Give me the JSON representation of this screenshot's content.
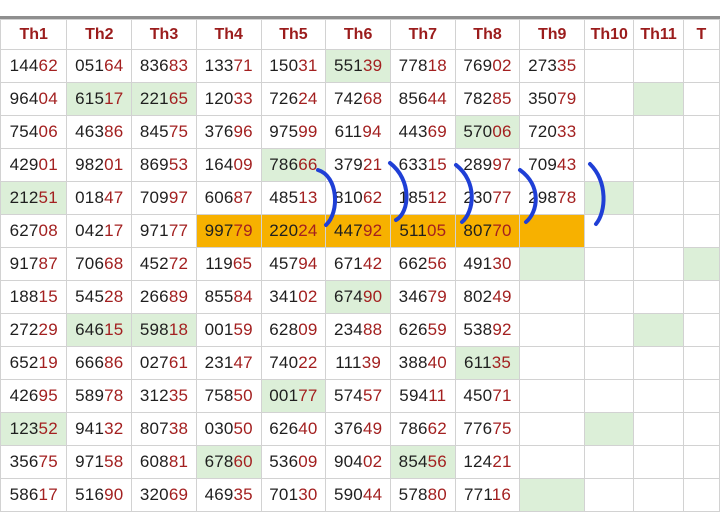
{
  "headers": [
    "Th1",
    "Th2",
    "Th3",
    "Th4",
    "Th5",
    "Th6",
    "Th7",
    "Th8",
    "Th9",
    "Th10",
    "Th11",
    "T"
  ],
  "rows": [
    [
      "14462",
      "05164",
      "83683",
      "13371",
      "15031",
      "55139",
      "77818",
      "76902",
      "27335",
      "",
      "",
      ""
    ],
    [
      "96404",
      "61517",
      "22165",
      "12033",
      "72624",
      "74268",
      "85644",
      "78285",
      "35079",
      "",
      "",
      ""
    ],
    [
      "75406",
      "46386",
      "84575",
      "37696",
      "97599",
      "61194",
      "44369",
      "57006",
      "72033",
      "",
      "",
      ""
    ],
    [
      "42901",
      "98201",
      "86953",
      "16409",
      "78666",
      "37921",
      "63315",
      "28997",
      "70943",
      "",
      "",
      ""
    ],
    [
      "21251",
      "01847",
      "70997",
      "60687",
      "48513",
      "81062",
      "18512",
      "23077",
      "29878",
      "",
      "",
      ""
    ],
    [
      "62708",
      "04217",
      "97177",
      "99779",
      "22024",
      "44792",
      "51105",
      "80770",
      "",
      "",
      "",
      ""
    ],
    [
      "91787",
      "70668",
      "45272",
      "11965",
      "45794",
      "67142",
      "66256",
      "49130",
      "",
      "",
      "",
      ""
    ],
    [
      "18815",
      "54528",
      "26689",
      "85584",
      "34102",
      "67490",
      "34679",
      "80249",
      "",
      "",
      "",
      ""
    ],
    [
      "27229",
      "64615",
      "59818",
      "00159",
      "62809",
      "23488",
      "62659",
      "53892",
      "",
      "",
      "",
      ""
    ],
    [
      "65219",
      "66686",
      "02761",
      "23147",
      "74022",
      "11139",
      "38840",
      "61135",
      "",
      "",
      "",
      ""
    ],
    [
      "42695",
      "58978",
      "31235",
      "75850",
      "00177",
      "57457",
      "59411",
      "45071",
      "",
      "",
      "",
      ""
    ],
    [
      "12352",
      "94132",
      "80738",
      "03050",
      "62640",
      "37649",
      "78662",
      "77675",
      "",
      "",
      "",
      ""
    ],
    [
      "35675",
      "97158",
      "60881",
      "67860",
      "53609",
      "90402",
      "85456",
      "12421",
      "",
      "",
      "",
      ""
    ],
    [
      "58617",
      "51690",
      "32069",
      "46935",
      "70130",
      "59044",
      "57880",
      "77116",
      "",
      "",
      "",
      ""
    ]
  ],
  "green_cells": [
    [
      0,
      5
    ],
    [
      1,
      1
    ],
    [
      1,
      2
    ],
    [
      1,
      10
    ],
    [
      2,
      7
    ],
    [
      3,
      4
    ],
    [
      4,
      0
    ],
    [
      4,
      9
    ],
    [
      6,
      8
    ],
    [
      6,
      11
    ],
    [
      7,
      5
    ],
    [
      8,
      1
    ],
    [
      8,
      2
    ],
    [
      8,
      10
    ],
    [
      9,
      7
    ],
    [
      10,
      4
    ],
    [
      11,
      0
    ],
    [
      11,
      9
    ],
    [
      12,
      3
    ],
    [
      12,
      6
    ],
    [
      13,
      8
    ]
  ],
  "orange_cells": [
    [
      5,
      3
    ],
    [
      5,
      4
    ],
    [
      5,
      5
    ],
    [
      5,
      6
    ],
    [
      5,
      7
    ],
    [
      5,
      8
    ]
  ],
  "colors": {
    "header_text": "#9b1c1c",
    "green": "#dcefd8",
    "orange": "#f7b100",
    "pen": "#1f3fd6"
  }
}
